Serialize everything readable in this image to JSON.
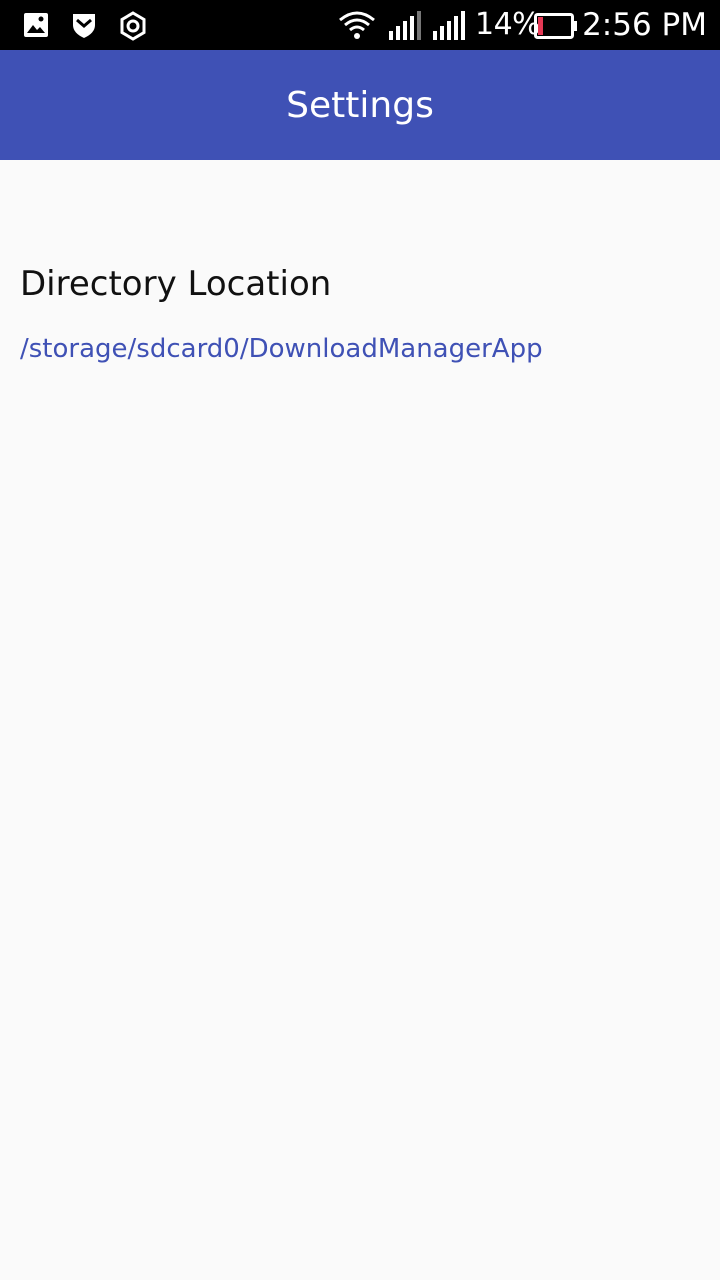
{
  "status_bar": {
    "battery_percent": "14%",
    "time": "2:56 PM",
    "icons": [
      "image-icon",
      "shield-icon",
      "settings-hex-icon",
      "wifi-icon",
      "signal-icon",
      "signal-icon",
      "battery-low-icon"
    ],
    "battery_level": 0.14,
    "battery_color": "#e53955"
  },
  "app_bar": {
    "title": "Settings",
    "color": "#3f51b5"
  },
  "preferences": [
    {
      "title": "Directory Location",
      "summary": "/storage/sdcard0/DownloadManagerApp"
    }
  ]
}
